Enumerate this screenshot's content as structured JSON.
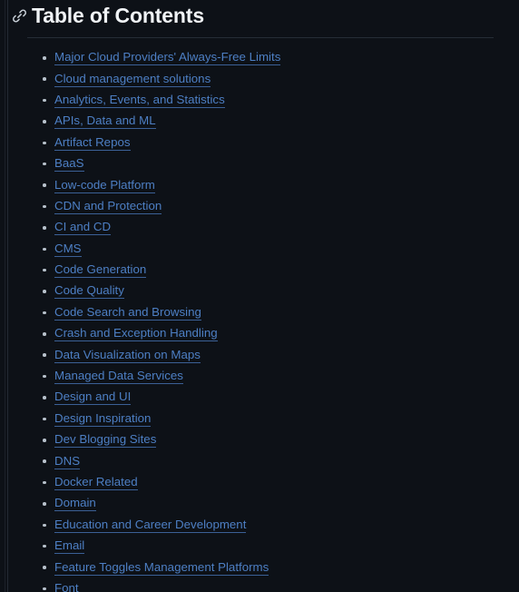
{
  "theme": {
    "background": "#0d1117",
    "heading_color": "#f0f3f6",
    "link_color": "#4d7fc4",
    "link_underline_color": "#3b6096",
    "bullet_color": "#b8c2cc",
    "rule_color": "#262d36"
  },
  "header": {
    "anchor_icon": "link-icon",
    "title": "Table of Contents"
  },
  "toc": {
    "items": [
      {
        "label": "Major Cloud Providers' Always-Free Limits"
      },
      {
        "label": "Cloud management solutions"
      },
      {
        "label": "Analytics, Events, and Statistics"
      },
      {
        "label": "APIs, Data and ML"
      },
      {
        "label": "Artifact Repos"
      },
      {
        "label": "BaaS"
      },
      {
        "label": "Low-code Platform"
      },
      {
        "label": "CDN and Protection"
      },
      {
        "label": "CI and CD"
      },
      {
        "label": "CMS"
      },
      {
        "label": "Code Generation"
      },
      {
        "label": "Code Quality"
      },
      {
        "label": "Code Search and Browsing"
      },
      {
        "label": "Crash and Exception Handling"
      },
      {
        "label": "Data Visualization on Maps"
      },
      {
        "label": "Managed Data Services"
      },
      {
        "label": "Design and UI"
      },
      {
        "label": "Design Inspiration"
      },
      {
        "label": "Dev Blogging Sites"
      },
      {
        "label": "DNS"
      },
      {
        "label": "Docker Related"
      },
      {
        "label": "Domain"
      },
      {
        "label": "Education and Career Development"
      },
      {
        "label": "Email"
      },
      {
        "label": "Feature Toggles Management Platforms"
      },
      {
        "label": "Font"
      }
    ]
  }
}
